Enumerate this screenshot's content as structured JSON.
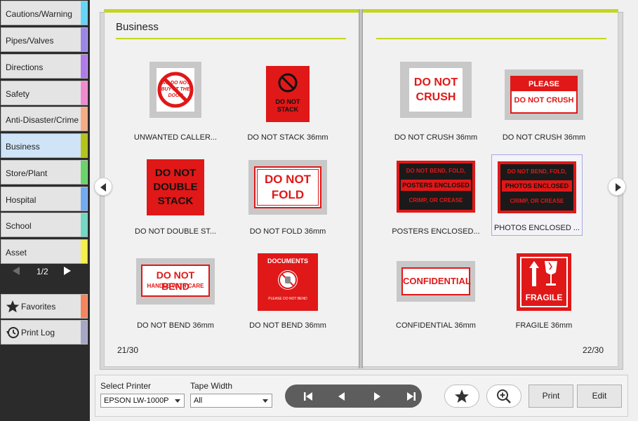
{
  "sidebar": {
    "categories": [
      {
        "label": "Cautions/Warning",
        "color": "#67d4f5"
      },
      {
        "label": "Pipes/Valves",
        "color": "#9b86e6"
      },
      {
        "label": "Directions",
        "color": "#b07ae8"
      },
      {
        "label": "Safety",
        "color": "#f08ad0"
      },
      {
        "label": "Anti-Disaster/Crime",
        "color": "#f7ab82"
      },
      {
        "label": "Business",
        "color": "#b6c31a",
        "selected": true
      },
      {
        "label": "Store/Plant",
        "color": "#6ad36a"
      },
      {
        "label": "Hospital",
        "color": "#72a9f0"
      },
      {
        "label": "School",
        "color": "#72d8c3"
      },
      {
        "label": "Asset",
        "color": "#f5f04a"
      }
    ],
    "pager": "1/2",
    "favorites_label": "Favorites",
    "favorites_color": "#f2855e",
    "printlog_label": "Print Log",
    "printlog_color": "#a6a6c6"
  },
  "book": {
    "section_title": "Business",
    "left_page_num": "21/30",
    "right_page_num": "22/30",
    "accent": "#c4d61f",
    "left_items": [
      {
        "label": "UNWANTED CALLER...",
        "icon": "no-sales-sign",
        "thumb_text": "WE DO NOT BUY AT THE DOOR"
      },
      {
        "label": "DO NOT STACK 36mm",
        "icon": "do-not-stack-sign",
        "thumb_text": "DO NOT STACK"
      },
      {
        "label": "DO NOT DOUBLE ST...",
        "icon": "do-not-double-stack-sign",
        "thumb_text": "DO NOT DOUBLE STACK"
      },
      {
        "label": "DO NOT FOLD 36mm",
        "icon": "do-not-fold-sign",
        "thumb_text": "DO NOT FOLD"
      },
      {
        "label": "DO NOT BEND 36mm",
        "icon": "do-not-bend-handle-sign",
        "thumb_text_1": "DO NOT BEND",
        "thumb_text_2": "HANDLE WITH CARE"
      },
      {
        "label": "DO NOT BEND 36mm",
        "icon": "documents-do-not-bend-sign",
        "thumb_text_1": "DOCUMENTS",
        "thumb_text_2": "PLEASE DO NOT BEND"
      }
    ],
    "right_items": [
      {
        "label": "DO NOT CRUSH 36mm",
        "icon": "do-not-crush-sign",
        "thumb_text_1": "DO NOT",
        "thumb_text_2": "CRUSH"
      },
      {
        "label": "DO NOT CRUSH 36mm",
        "icon": "please-do-not-crush-sign",
        "thumb_text_1": "PLEASE",
        "thumb_text_2": "DO NOT CRUSH"
      },
      {
        "label": "POSTERS ENCLOSED...",
        "icon": "posters-enclosed-sign",
        "thumb_text_1": "DO NOT BEND, FOLD,",
        "thumb_text_2": "POSTERS ENCLOSED",
        "thumb_text_3": "CRIMP, OR CREASE"
      },
      {
        "label": "PHOTOS ENCLOSED ...",
        "icon": "photos-enclosed-sign",
        "thumb_text_1": "DO NOT BEND, FOLD,",
        "thumb_text_2": "PHOTOS ENCLOSED",
        "thumb_text_3": "CRIMP, OR CREASE",
        "selected": true
      },
      {
        "label": "CONFIDENTIAL 36mm",
        "icon": "confidential-sign",
        "thumb_text": "CONFIDENTIAL"
      },
      {
        "label": "FRAGILE 36mm",
        "icon": "fragile-sign",
        "thumb_text": "FRAGILE"
      }
    ]
  },
  "bottombar": {
    "printer_label": "Select Printer",
    "printer_value": "EPSON LW-1000P",
    "tape_label": "Tape Width",
    "tape_value": "All",
    "print_label": "Print",
    "edit_label": "Edit"
  },
  "colors": {
    "sign_red": "#e01818",
    "thumb_bg": "#c8c8c8"
  }
}
